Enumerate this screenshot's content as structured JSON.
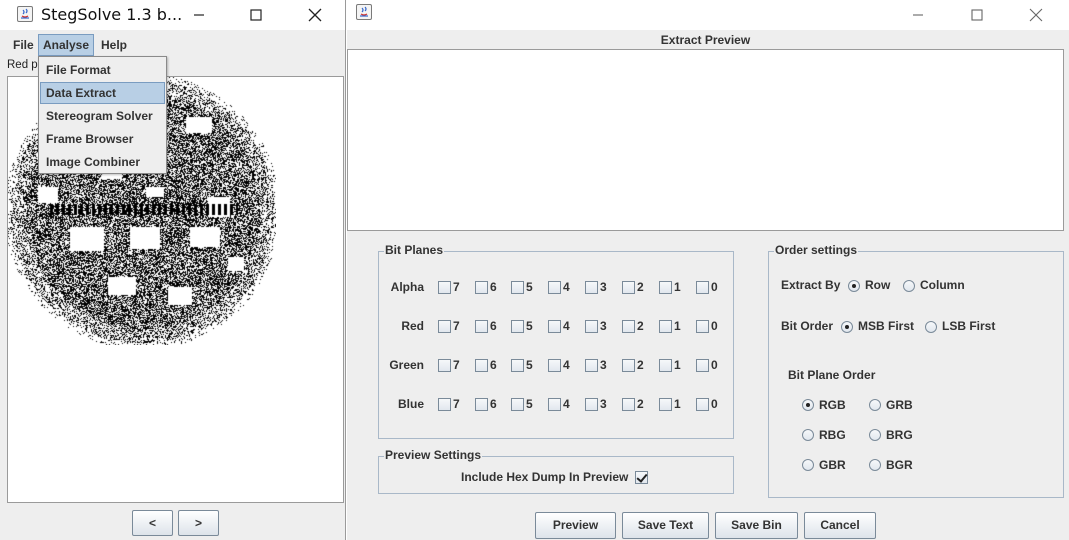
{
  "main_window": {
    "title": "StegSolve 1.3 b...",
    "menu": {
      "file": "File",
      "analyse": "Analyse",
      "help": "Help"
    },
    "panel_label": "Red p",
    "analyse_menu": [
      "File Format",
      "Data Extract",
      "Stereogram Solver",
      "Frame Browser",
      "Image Combiner"
    ],
    "nav": {
      "prev": "<",
      "next": ">"
    }
  },
  "extract_window": {
    "preview_title": "Extract Preview",
    "bit_planes": {
      "title": "Bit Planes",
      "rows": [
        "Alpha",
        "Red",
        "Green",
        "Blue"
      ],
      "bits": [
        "7",
        "6",
        "5",
        "4",
        "3",
        "2",
        "1",
        "0"
      ]
    },
    "preview_settings": {
      "title": "Preview Settings",
      "include_hex_label": "Include Hex Dump In Preview",
      "include_hex_checked": true
    },
    "order_settings": {
      "title": "Order settings",
      "extract_by_label": "Extract By",
      "extract_by_options": [
        "Row",
        "Column"
      ],
      "extract_by_selected": "Row",
      "bit_order_label": "Bit Order",
      "bit_order_options": [
        "MSB First",
        "LSB First"
      ],
      "bit_order_selected": "MSB First",
      "bit_plane_order_label": "Bit Plane Order",
      "bit_plane_order_options": [
        "RGB",
        "GRB",
        "RBG",
        "BRG",
        "GBR",
        "BGR"
      ],
      "bit_plane_order_selected": "RGB"
    },
    "buttons": {
      "preview": "Preview",
      "save_text": "Save Text",
      "save_bin": "Save Bin",
      "cancel": "Cancel"
    }
  },
  "colors": {
    "menu_highlight": "#b8cfe5",
    "window_bg": "#eeeeee",
    "groupbox_border": "#a9b8c8"
  }
}
